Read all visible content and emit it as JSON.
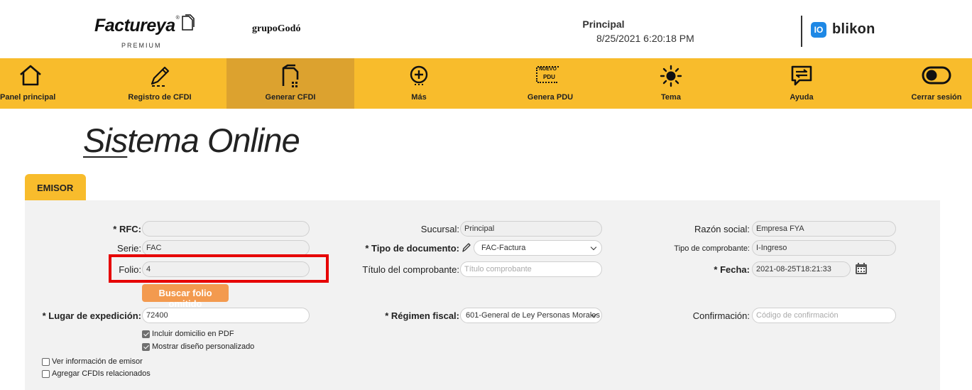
{
  "header": {
    "brand_name": "Factureya",
    "brand_tier": "PREMIUM",
    "partner_logo": "grupoGodó",
    "sucursal": "Principal",
    "datetime": "8/25/2021 6:20:18 PM",
    "sponsor_mark": "IO",
    "sponsor_name": "blikon"
  },
  "nav": {
    "items": [
      {
        "label": "Panel principal",
        "icon": "home-icon"
      },
      {
        "label": "Registro de CFDI",
        "icon": "pencil-icon"
      },
      {
        "label": "Generar CFDI",
        "icon": "document-icon",
        "active": true
      },
      {
        "label": "Más",
        "icon": "plus-circle-icon"
      },
      {
        "label": "Genera PDU",
        "icon": "pdu-icon",
        "badge": "NUEVO",
        "badge2": "PDU"
      },
      {
        "label": "Tema",
        "icon": "sun-icon"
      },
      {
        "label": "Ayuda",
        "icon": "chat-icon"
      },
      {
        "label": "Cerrar sesión",
        "icon": "toggle-icon"
      }
    ]
  },
  "page": {
    "title_underlined": "Sis",
    "title_rest": "tema Online"
  },
  "emisor": {
    "tab_label": "EMISOR",
    "rfc": {
      "label": "* RFC:",
      "value": ""
    },
    "serie": {
      "label": "Serie:",
      "value": "FAC"
    },
    "folio": {
      "label": "Folio:",
      "value": "4"
    },
    "buscar_folio": "Buscar folio omitido",
    "lugar_expedicion": {
      "label": "* Lugar de expedición:",
      "value": "72400"
    },
    "incluir_domicilio": {
      "label": "Incluir domicilio en PDF",
      "checked": true
    },
    "mostrar_diseno": {
      "label": "Mostrar diseño personalizado",
      "checked": true
    },
    "ver_info": {
      "label": "Ver información de emisor",
      "checked": false
    },
    "agregar_cfdis": {
      "label": "Agregar CFDIs relacionados",
      "checked": false
    },
    "sucursal": {
      "label": "Sucursal:",
      "value": "Principal"
    },
    "tipo_documento": {
      "label": "* Tipo de documento:",
      "value": "FAC-Factura"
    },
    "titulo_comprobante": {
      "label": "Título del comprobante:",
      "placeholder": "Título comprobante"
    },
    "regimen_fiscal": {
      "label": "* Régimen fiscal:",
      "value": "601-General de Ley Personas Morales"
    },
    "razon_social": {
      "label": "Razón social:",
      "value": "Empresa FYA"
    },
    "tipo_comprobante": {
      "label": "Tipo de comprobante:",
      "value": "I-Ingreso"
    },
    "fecha": {
      "label": "* Fecha:",
      "value": "2021-08-25T18:21:33"
    },
    "confirmacion": {
      "label": "Confirmación:",
      "placeholder": "Código de confirmación"
    }
  },
  "colors": {
    "nav_bg": "#f8bc2c",
    "nav_active": "#dca22f",
    "highlight": "#e60000",
    "button": "#f39a4f"
  }
}
